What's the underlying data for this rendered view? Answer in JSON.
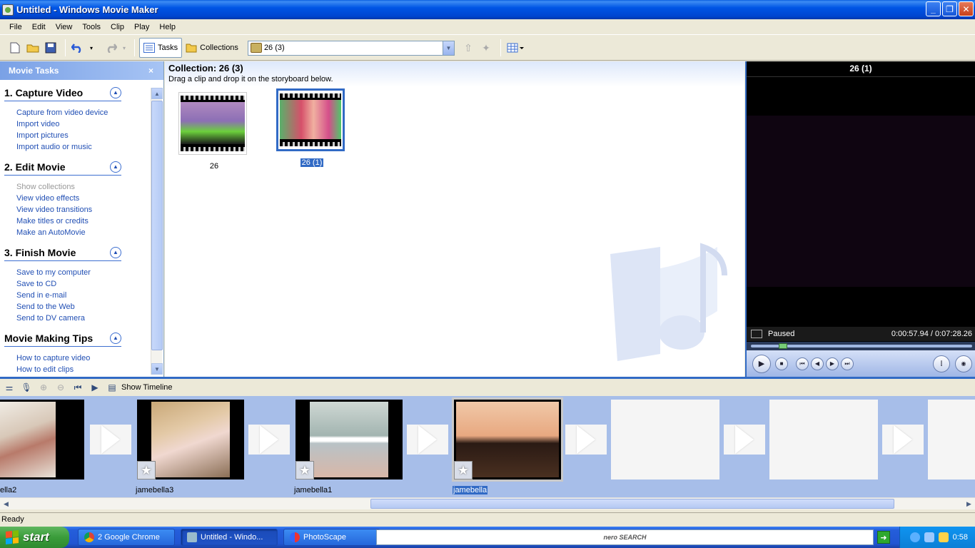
{
  "window": {
    "title": "Untitled - Windows Movie Maker",
    "min_glyph": "_",
    "max_glyph": "❐",
    "close_glyph": "✕"
  },
  "menu": [
    "File",
    "Edit",
    "View",
    "Tools",
    "Clip",
    "Play",
    "Help"
  ],
  "toolbar": {
    "tasks_label": "Tasks",
    "collections_label": "Collections",
    "collection_select_value": "26 (3)"
  },
  "task_pane": {
    "title": "Movie Tasks",
    "close_glyph": "×",
    "sections": [
      {
        "title": "1. Capture Video",
        "links": [
          "Capture from video device",
          "Import video",
          "Import pictures",
          "Import audio or music"
        ]
      },
      {
        "title": "2. Edit Movie",
        "links": [
          "Show collections",
          "View video effects",
          "View video transitions",
          "Make titles or credits",
          "Make an AutoMovie"
        ]
      },
      {
        "title": "3. Finish Movie",
        "links": [
          "Save to my computer",
          "Save to CD",
          "Send in e-mail",
          "Send to the Web",
          "Send to DV camera"
        ]
      },
      {
        "title": "Movie Making Tips",
        "links": [
          "How to capture video",
          "How to edit clips"
        ]
      }
    ]
  },
  "collection": {
    "title": "Collection: 26 (3)",
    "subtitle": "Drag a clip and drop it on the storyboard below.",
    "clips": [
      {
        "label": "26",
        "selected": false
      },
      {
        "label": "26 (1)",
        "selected": true
      }
    ]
  },
  "monitor": {
    "title": "26 (1)",
    "status": "Paused",
    "time": "0:00:57.94 / 0:07:28.26",
    "seek_fraction": 0.13
  },
  "storyboard_toolbar": {
    "show_timeline_label": "Show Timeline"
  },
  "storyboard": {
    "clips": [
      {
        "label": "ella2"
      },
      {
        "label": "jamebella3"
      },
      {
        "label": "jamebella1"
      },
      {
        "label": "jamebella",
        "selected": true
      }
    ]
  },
  "statusbar": {
    "text": "Ready"
  },
  "taskbar": {
    "start_label": "start",
    "items": [
      {
        "label": "2 Google Chrome",
        "active": false
      },
      {
        "label": "Untitled - Windo...",
        "active": true
      },
      {
        "label": "PhotoScape",
        "active": false
      }
    ],
    "search_brand": "nero SEARCH",
    "clock": "0:58"
  },
  "colors": {
    "selection": "#316ac5",
    "link": "#214fb4",
    "storyboard_bg": "#a7bee9"
  }
}
